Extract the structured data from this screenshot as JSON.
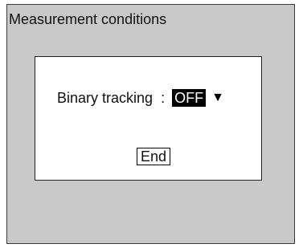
{
  "screen": {
    "title": "Measurement conditions"
  },
  "dialog": {
    "setting": {
      "label": "Binary tracking",
      "separator": ":",
      "value": "OFF",
      "arrow_icon": "triangle-down-icon"
    },
    "end_button": "End"
  },
  "colors": {
    "screen_background": "#c9c9c9",
    "dialog_background": "#ffffff",
    "selected_value_background": "#000000",
    "selected_value_text": "#ffffff"
  }
}
